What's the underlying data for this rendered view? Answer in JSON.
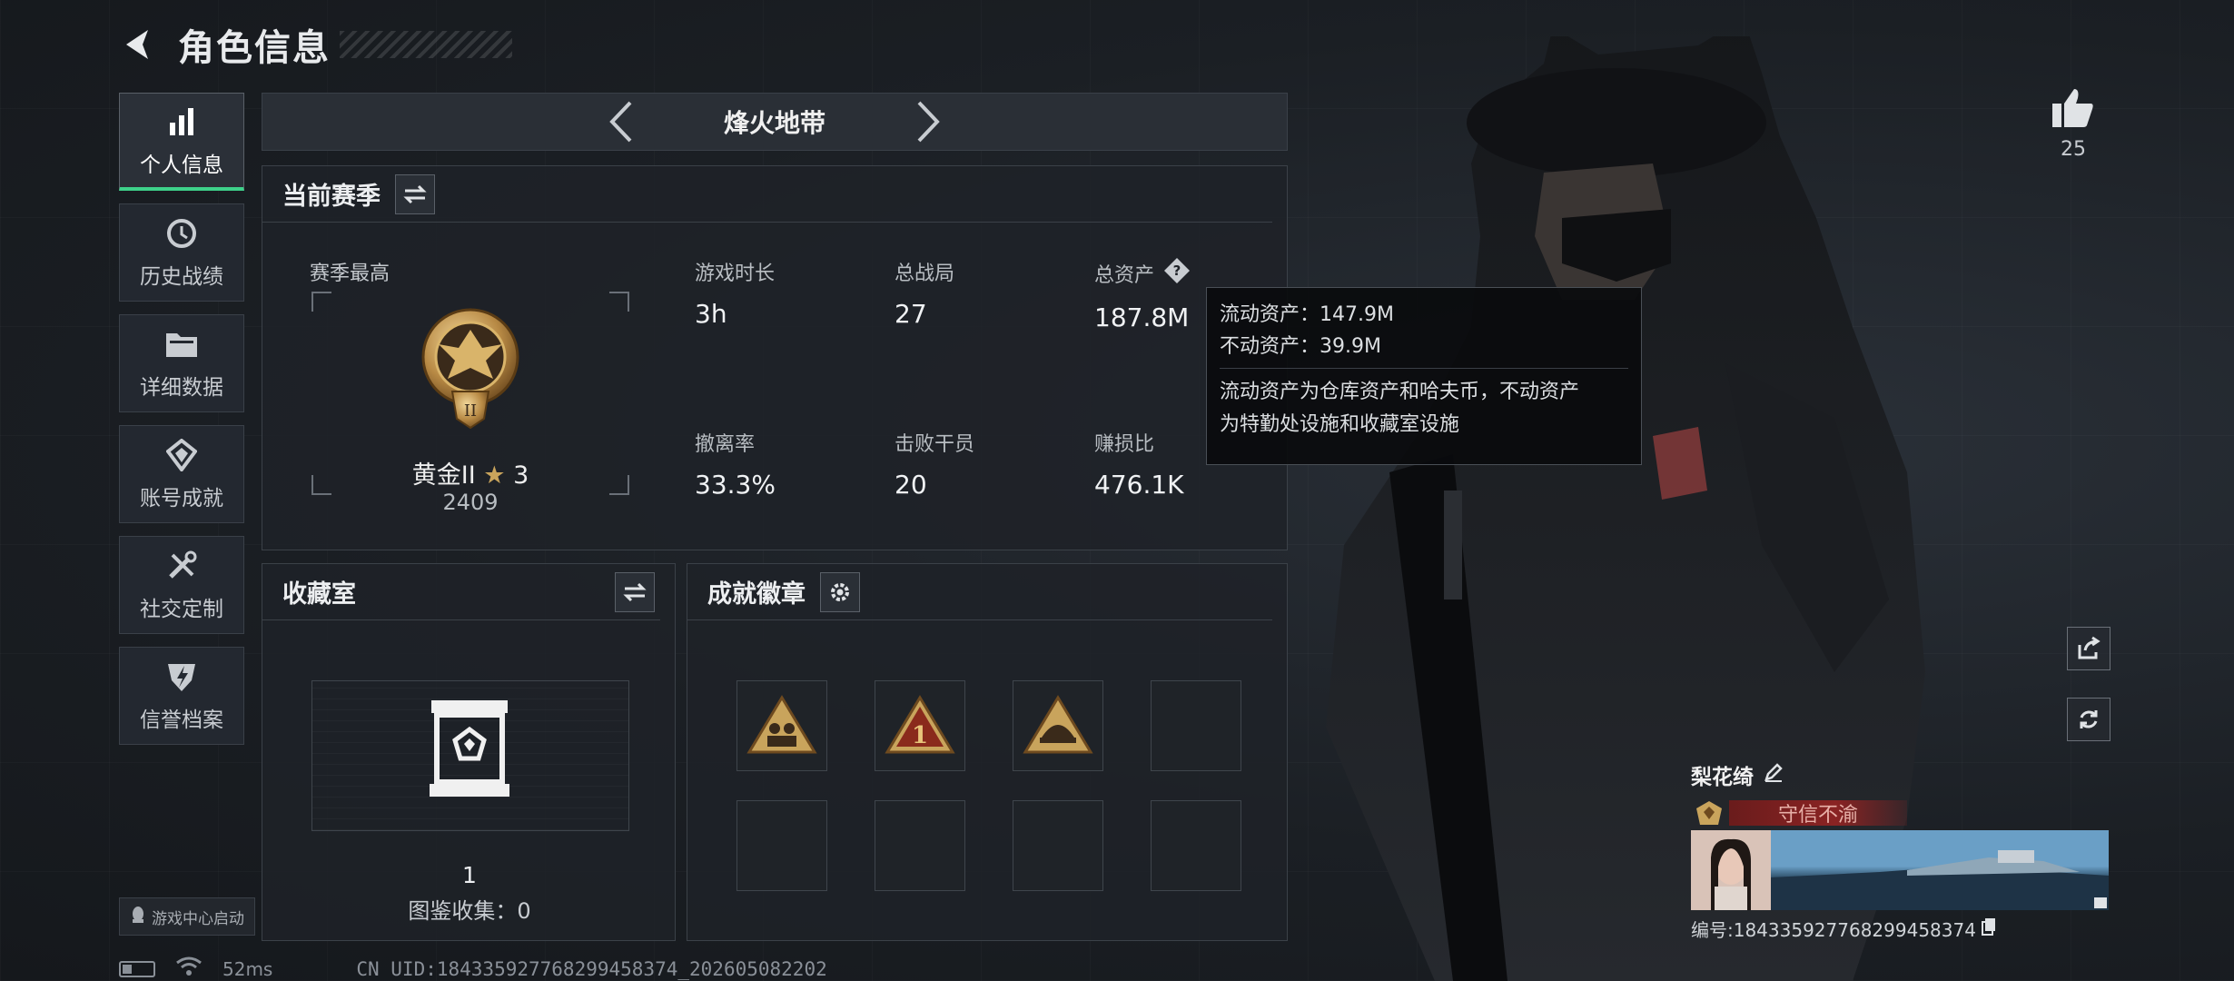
{
  "header": {
    "title": "角色信息"
  },
  "sidebar": {
    "items": [
      {
        "label": "个人信息",
        "icon": "bar-chart-icon",
        "active": true
      },
      {
        "label": "历史战绩",
        "icon": "history-clock-icon",
        "active": false
      },
      {
        "label": "详细数据",
        "icon": "folder-icon",
        "active": false
      },
      {
        "label": "账号成就",
        "icon": "achievement-icon",
        "active": false
      },
      {
        "label": "社交定制",
        "icon": "tools-icon",
        "active": false
      },
      {
        "label": "信誉档案",
        "icon": "credit-shield-icon",
        "active": false
      }
    ],
    "launch_label": "游戏中心启动"
  },
  "status": {
    "ping": "52ms",
    "uid_line": "CN UID:184335927768299458374_202605082202"
  },
  "mode": {
    "title": "烽火地带"
  },
  "season": {
    "title": "当前赛季",
    "best_label": "赛季最高",
    "rank_name": "黄金II",
    "rank_stars": "3",
    "rank_score": "2409",
    "rank_badge_numeral": "II",
    "stats": {
      "play_time": {
        "label": "游戏时长",
        "value": "3h"
      },
      "total_matches": {
        "label": "总战局",
        "value": "27"
      },
      "total_assets": {
        "label": "总资产",
        "value": "187.8M"
      },
      "extract_rate": {
        "label": "撤离率",
        "value": "33.3%"
      },
      "kills": {
        "label": "击败干员",
        "value": "20"
      },
      "profit_ratio": {
        "label": "赚损比",
        "value": "476.1K"
      }
    }
  },
  "tooltip": {
    "liquid": "流动资产：147.9M",
    "fixed": "不动资产：39.9M",
    "desc_line1": "流动资产为仓库资产和哈夫币，不动资产",
    "desc_line2": "为特勤处设施和收藏室设施"
  },
  "vault": {
    "title": "收藏室",
    "count": "1",
    "collect_label": "图鉴收集：0"
  },
  "badges": {
    "title": "成就徽章",
    "badge_numeral": "1"
  },
  "likes": {
    "count": "25"
  },
  "profile": {
    "name": "梨花绮",
    "title": "守信不渝",
    "uid": "编号:184335927768299458374"
  },
  "colors": {
    "accent": "#3ed18a",
    "gold": "#c9a45c",
    "banner": "#8a2323"
  }
}
